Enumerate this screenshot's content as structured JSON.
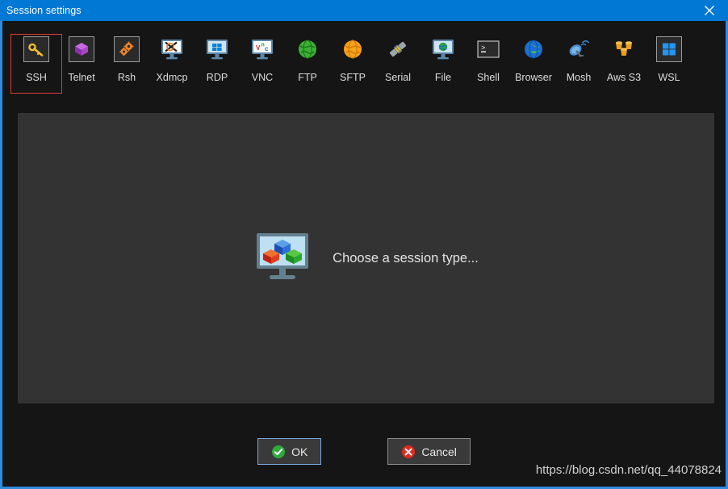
{
  "titlebar": {
    "title": "Session settings",
    "close_label": "close-icon"
  },
  "toolbar": {
    "items": [
      {
        "label": "SSH",
        "icon": "key-icon",
        "selected": true
      },
      {
        "label": "Telnet",
        "icon": "purple-cube-icon",
        "selected": false
      },
      {
        "label": "Rsh",
        "icon": "orange-gears-icon",
        "selected": false
      },
      {
        "label": "Xdmcp",
        "icon": "x-window-monitor-icon",
        "selected": false
      },
      {
        "label": "RDP",
        "icon": "windows-monitor-icon",
        "selected": false
      },
      {
        "label": "VNC",
        "icon": "vnc-monitor-icon",
        "selected": false
      },
      {
        "label": "FTP",
        "icon": "green-globe-icon",
        "selected": false
      },
      {
        "label": "SFTP",
        "icon": "orange-globe-icon",
        "selected": false
      },
      {
        "label": "Serial",
        "icon": "serial-plug-icon",
        "selected": false
      },
      {
        "label": "File",
        "icon": "file-monitor-globe-icon",
        "selected": false
      },
      {
        "label": "Shell",
        "icon": "terminal-prompt-icon",
        "selected": false
      },
      {
        "label": "Browser",
        "icon": "blue-globe-icon",
        "selected": false
      },
      {
        "label": "Mosh",
        "icon": "satellite-dish-icon",
        "selected": false
      },
      {
        "label": "Aws S3",
        "icon": "aws-buckets-icon",
        "selected": false
      },
      {
        "label": "WSL",
        "icon": "windows-logo-icon",
        "selected": false
      }
    ]
  },
  "panel": {
    "placeholder_text": "Choose a session type...",
    "placeholder_icon": "monitor-cubes-icon"
  },
  "buttons": {
    "ok_label": "OK",
    "ok_icon": "green-check-icon",
    "cancel_label": "Cancel",
    "cancel_icon": "red-cross-icon"
  },
  "watermark": {
    "text": "https://blog.csdn.net/qq_44078824"
  },
  "colors": {
    "titlebar": "#0078d4",
    "window_border": "#2e8bdd",
    "window_bg": "#151515",
    "panel_bg": "#333333",
    "selection_border": "#e03b32",
    "ok_focus_border": "#7aa7e0"
  }
}
